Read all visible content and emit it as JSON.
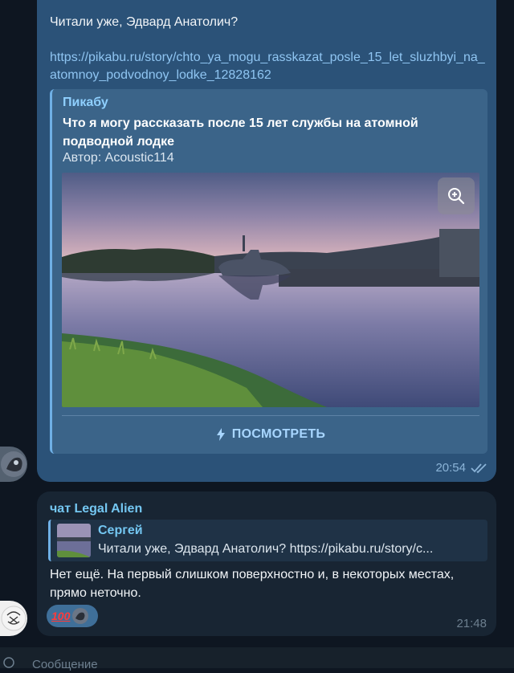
{
  "outgoing_message": {
    "text": "Читали уже, Эдвард Анатолич?",
    "link": "https://pikabu.ru/story/chto_ya_mogu_rasskazat_posle_15_let_sluzhbyi_na_atomnoy_podvodnoy_lodke_12828162",
    "preview": {
      "site_name": "Пикабу",
      "title": "Что я могу рассказать после 15 лет службы на атомной подводной лодке",
      "author": "Автор: Acoustic114",
      "view_button_label": "ПОСМОТРЕТЬ"
    },
    "time": "20:54",
    "read_status_icon": "double-check-icon"
  },
  "incoming_message": {
    "sender": "чат Legal Alien",
    "reply": {
      "name": "Сергей",
      "text": "Читали уже, Эдвард Анатолич?  https://pikabu.ru/story/c..."
    },
    "text": "Нет ещё. На первый слишком поверхностно и, в некоторых местах, прямо неточно.",
    "reactions": [
      "100-emoji",
      "reactor-avatar"
    ],
    "time": "21:48"
  },
  "composer": {
    "placeholder": "Сообщение"
  },
  "colors": {
    "background": "#0e1621",
    "outgoing_bubble": "#2b5278",
    "incoming_bubble": "#182533",
    "link": "#8fc5f2",
    "accent": "#74c7f2"
  }
}
